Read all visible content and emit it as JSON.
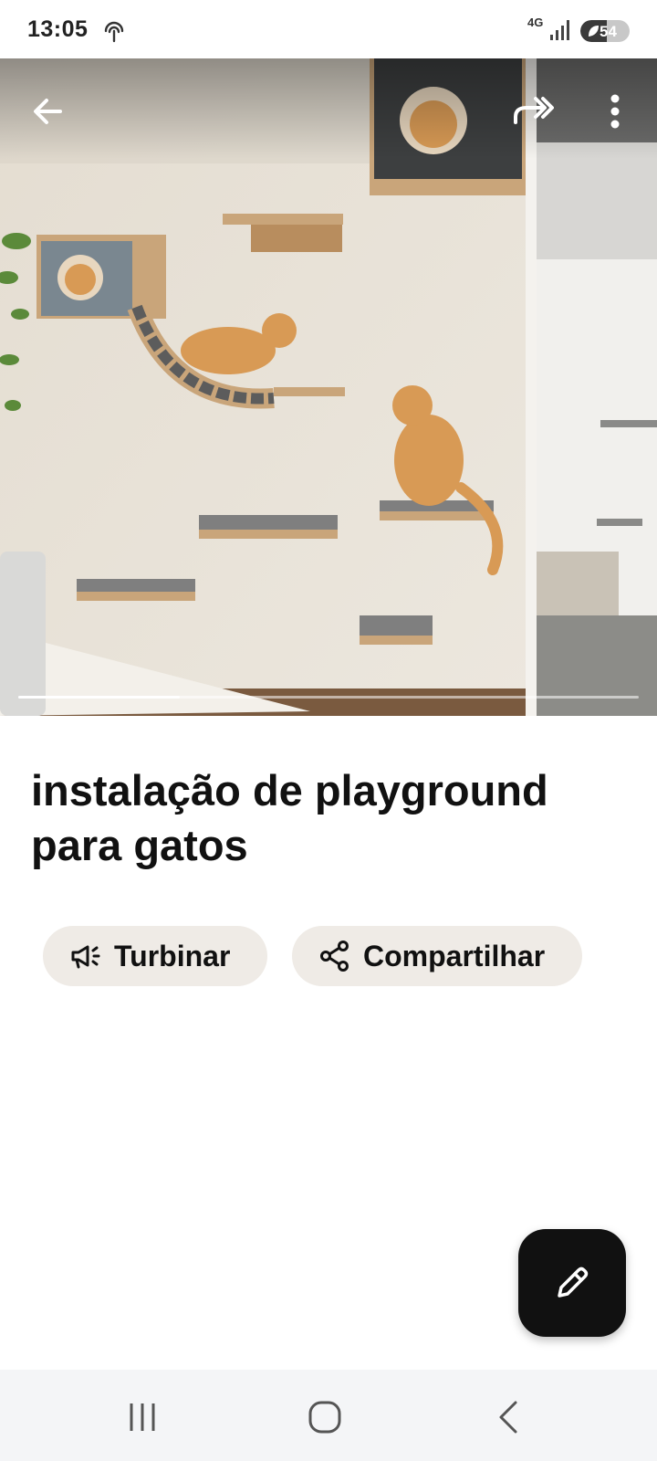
{
  "status_bar": {
    "time": "13:05",
    "network": "4G",
    "battery_level": "54",
    "battery_fraction": 0.54,
    "icons": [
      "hotspot-icon",
      "signal-icon",
      "battery-saver-icon"
    ]
  },
  "carousel": {
    "slide_count": 2,
    "progress_fraction": 0.26,
    "icons": [
      "arrow-left-icon",
      "share-forward-icon",
      "more-vertical-icon"
    ]
  },
  "pin": {
    "title": "instalação de playground para gatos"
  },
  "actions": {
    "promote_label": "Turbinar",
    "promote_icon": "megaphone-icon",
    "share_label": "Compartilhar",
    "share_icon": "share-icon"
  },
  "fab": {
    "icon": "pencil-icon"
  },
  "system_nav": {
    "icons": [
      "recents-icon",
      "home-icon",
      "back-icon"
    ]
  },
  "colors": {
    "chip_background": "#efebe6",
    "fab_background": "#111111",
    "text": "#111111",
    "nav_background": "#f4f5f7"
  }
}
